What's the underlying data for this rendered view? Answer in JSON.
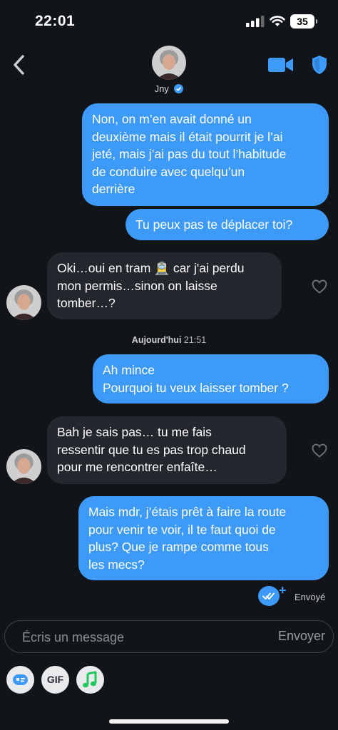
{
  "status_bar": {
    "time": "22:01",
    "battery": "35"
  },
  "header": {
    "contact_name": "Jny",
    "icons": [
      "back-chevron-icon",
      "video-call-icon",
      "shield-icon",
      "verified-badge-icon"
    ]
  },
  "messages": [
    {
      "direction": "out",
      "text": "Non, on m’en avait donné un\ndeuxième mais il était pourrit je l’ai\njeté, mais j’ai pas du tout l’habitude\nde conduire avec quelqu’un\nderrière"
    },
    {
      "direction": "out",
      "text": "Tu peux pas te déplacer toi?"
    },
    {
      "direction": "in",
      "text_before_emoji": "Oki…oui en tram ",
      "emoji": "🚊",
      "text_after_emoji": " car j'ai perdu\nmon permis…sinon on laisse\ntomber…?"
    },
    {
      "direction": "out",
      "text": "Ah mince\nPourquoi tu veux laisser tomber ?"
    },
    {
      "direction": "in",
      "text": "Bah je sais pas… tu me fais\nressentir que tu es pas trop chaud\npour me rencontrer enfaîte…"
    },
    {
      "direction": "out",
      "text": "Mais mdr, j’étais prêt à faire la route\npour venir te voir, il te faut quoi de\nplus? Que je rampe comme tous\nles mecs?"
    }
  ],
  "timestamp": {
    "day": "Aujourd'hui",
    "time": "21:51"
  },
  "delivery": {
    "status": "Envoyé"
  },
  "composer": {
    "placeholder": "Écris un message",
    "send_label": "Envoyer"
  },
  "toolbar": {
    "gif_label": "GIF",
    "icons": [
      "sticker-icon",
      "gif-icon",
      "music-icon"
    ]
  },
  "colors": {
    "background": "#111418",
    "outgoing_bubble": "#3d9bf7",
    "incoming_bubble": "#24272d",
    "accent": "#3d9bf7"
  }
}
